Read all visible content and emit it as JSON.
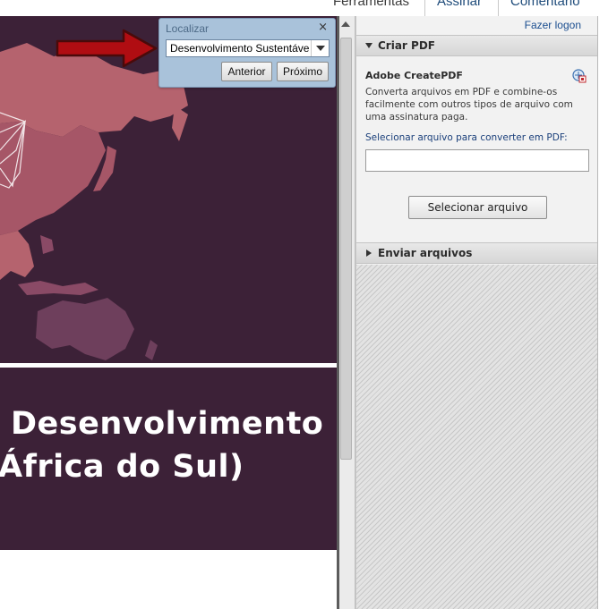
{
  "toolbar": {
    "tools_label": "Ferramentas",
    "sign_label": "Assinar",
    "comment_label": "Comentário"
  },
  "find": {
    "title": "Localizar",
    "close_glyph": "×",
    "query": "Desenvolvimento Sustentável",
    "previous_label": "Anterior",
    "next_label": "Próximo"
  },
  "document": {
    "title_line1": "Desenvolvimento",
    "title_line2": "África do Sul)",
    "colors": {
      "map_background": "#3c2137",
      "land": "#b5636e",
      "land_dark": "#6e3f5c"
    }
  },
  "panel": {
    "login_label": "Fazer logon",
    "create_pdf": {
      "header": "Criar PDF",
      "service_title": "Adobe CreatePDF",
      "service_icon": "pdf-convert-icon",
      "description": "Converta arquivos em PDF e combine-os facilmente com outros tipos de arquivo com uma assinatura paga.",
      "select_prompt": "Selecionar arquivo para converter em PDF:",
      "file_value": "",
      "select_button": "Selecionar arquivo"
    },
    "send_files": {
      "header": "Enviar arquivos"
    }
  },
  "icons": {
    "find_close": "close-icon",
    "find_dropdown": "chevron-down-icon",
    "section_expanded": "triangle-down-icon",
    "section_collapsed": "triangle-right-icon",
    "annotation_arrow": "arrow-right-icon"
  }
}
